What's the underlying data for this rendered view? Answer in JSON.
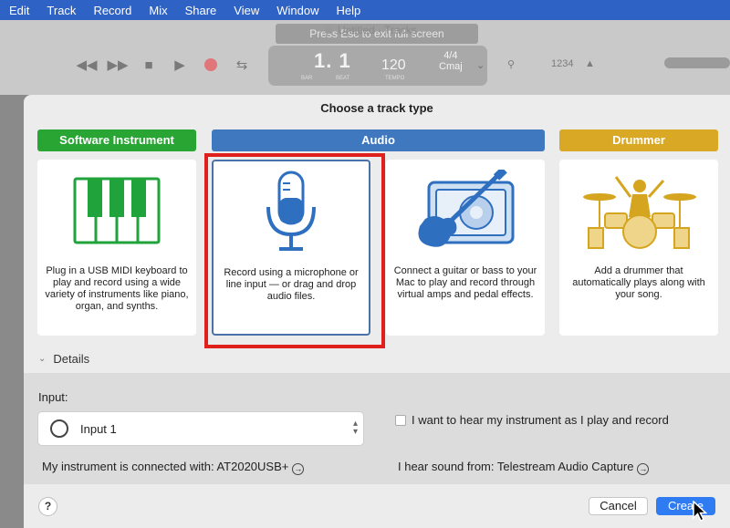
{
  "menubar": {
    "items": [
      {
        "label": "Edit"
      },
      {
        "label": "Track"
      },
      {
        "label": "Record"
      },
      {
        "label": "Mix"
      },
      {
        "label": "Share"
      },
      {
        "label": "View"
      },
      {
        "label": "Window"
      },
      {
        "label": "Help"
      }
    ],
    "color": "#2e62c4"
  },
  "background_window": {
    "esc_hint": "Press Esc to exit full screen",
    "title": "Untitled - Tracks",
    "lcd": {
      "position": "1. 1",
      "bar_label": "BAR",
      "beat_label": "BEAT",
      "tempo": "120",
      "tempo_label": "TEMPO",
      "time_signature": "4/4",
      "key": "Cmaj"
    },
    "count_in": "1234"
  },
  "dialog": {
    "title": "Choose a track type",
    "categories": [
      {
        "label": "Software Instrument",
        "color": "#28a532"
      },
      {
        "label": "Audio",
        "color": "#3f78bf"
      },
      {
        "label": "Drummer",
        "color": "#d9a925"
      }
    ],
    "cards": [
      {
        "icon": "piano-keyboard-icon",
        "description": "Plug in a USB MIDI keyboard to play and record using a wide variety of instruments like piano, organ, and synths."
      },
      {
        "icon": "microphone-icon",
        "description": "Record using a microphone or line input — or drag and drop audio files.",
        "selected": true
      },
      {
        "icon": "guitar-amp-icon",
        "description": "Connect a guitar or bass to your Mac to play and record through virtual amps and pedal effects."
      },
      {
        "icon": "drummer-icon",
        "description": "Add a drummer that automatically plays along with your song."
      }
    ],
    "details_label": "Details",
    "input_label": "Input:",
    "input_value": "Input 1",
    "connected_with": "My instrument is connected with: AT2020USB+",
    "hear_checkbox_label": "I want to hear my instrument as I play and record",
    "hear_checkbox_checked": false,
    "sound_from": "I hear sound from: Telestream Audio Capture",
    "help_label": "?",
    "cancel_label": "Cancel",
    "create_label": "Create",
    "accent_color": "#2f7cf2",
    "highlight_color": "#e0201c"
  }
}
